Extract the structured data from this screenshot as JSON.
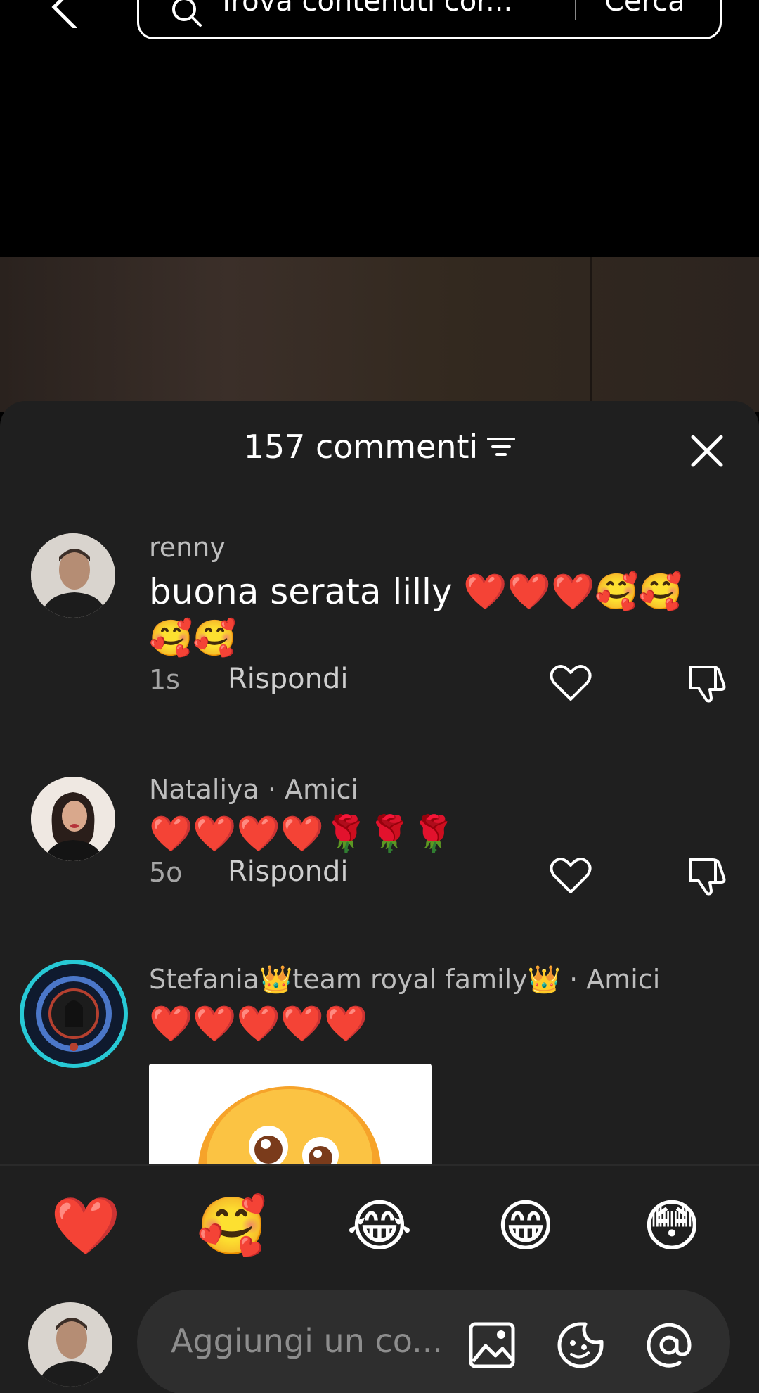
{
  "search": {
    "placeholder": "Trova contenuti cor...",
    "button": "Cerca"
  },
  "sheet": {
    "count_label": "157 commenti"
  },
  "comments": [
    {
      "user": "renny",
      "text": "buona serata lilly ❤️❤️❤️🥰🥰🥰🥰",
      "time": "1s",
      "reply": "Rispondi"
    },
    {
      "user": "Nataliya · Amici",
      "text": "❤️❤️❤️❤️🌹🌹🌹",
      "time": "5o",
      "reply": "Rispondi"
    },
    {
      "user": "Stefania👑team royal family👑 · Amici",
      "text": "❤️❤️❤️❤️❤️"
    }
  ],
  "reactions": [
    "❤️",
    "🥰",
    "😂",
    "😁",
    "😳"
  ],
  "input": {
    "placeholder": "Aggiungi un co..."
  },
  "colors": {
    "sheet_bg": "#1f1f1f",
    "heart": "#ff3b6b"
  }
}
